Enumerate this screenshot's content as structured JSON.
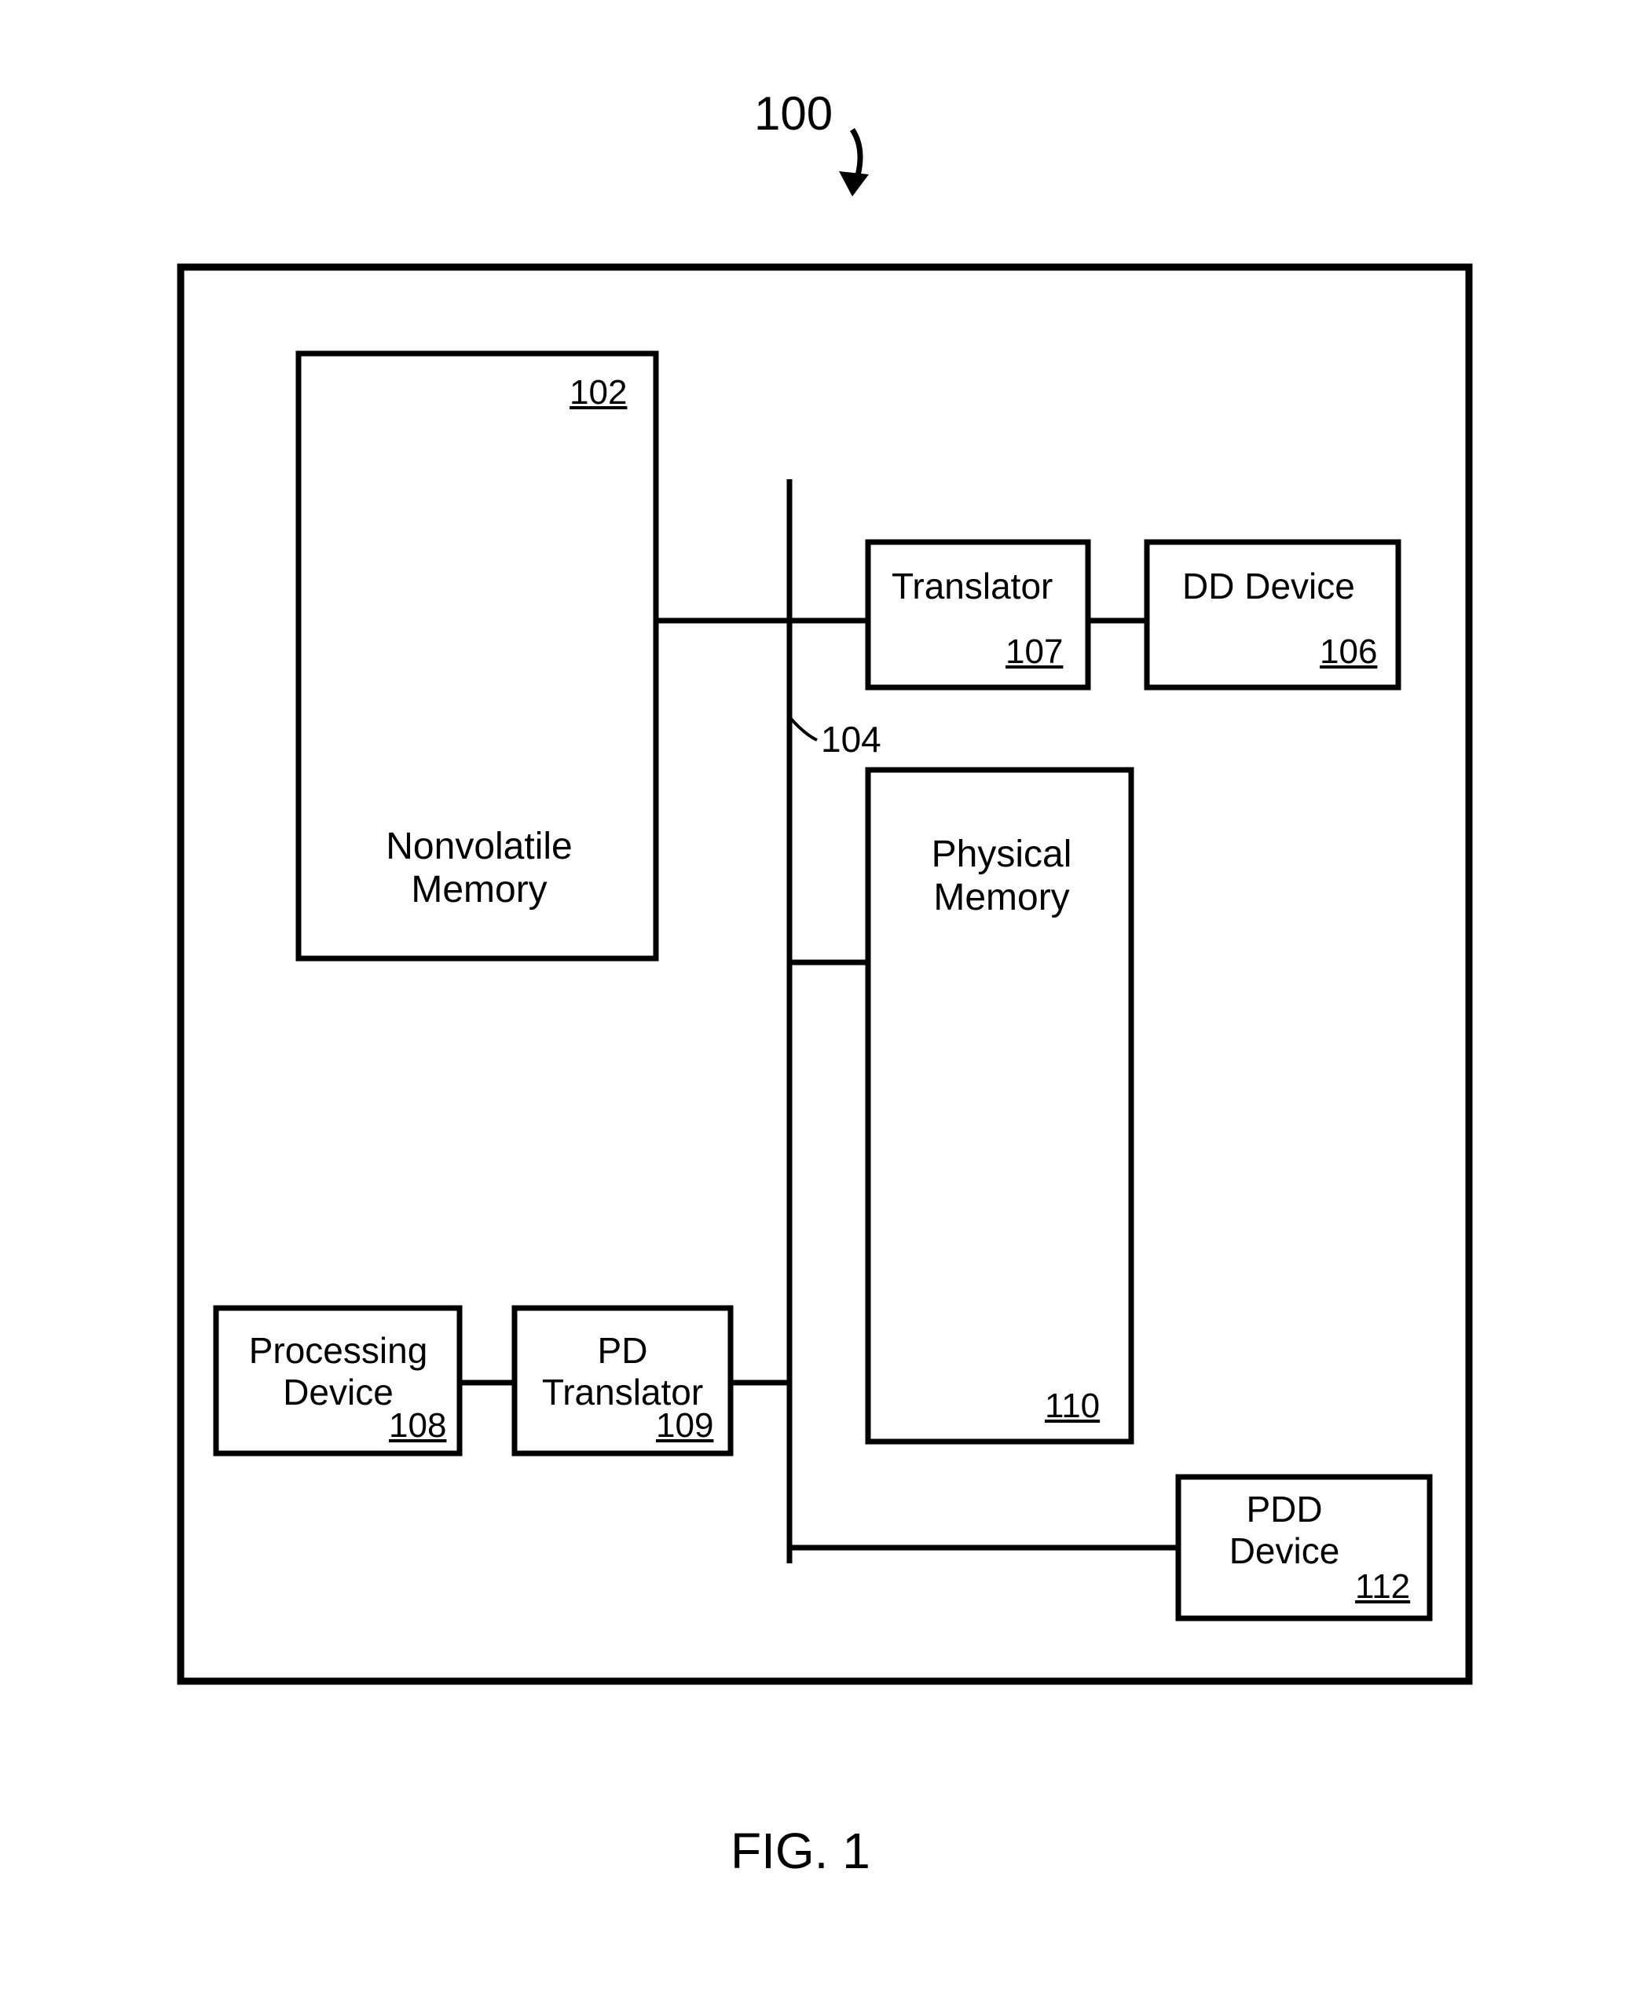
{
  "figure": {
    "caption": "FIG. 1",
    "topRef": "100"
  },
  "blocks": {
    "nvm": {
      "label": "Nonvolatile\nMemory",
      "ref": "102"
    },
    "trans": {
      "label": "Translator",
      "ref": "107"
    },
    "dd": {
      "label": "DD Device",
      "ref": "106"
    },
    "pm": {
      "label": "Physical\nMemory",
      "ref": "110"
    },
    "proc": {
      "label": "Processing\nDevice",
      "ref": "108"
    },
    "pdt": {
      "label": "PD\nTranslator",
      "ref": "109"
    },
    "pdd": {
      "label": "PDD\nDevice",
      "ref": "112"
    }
  },
  "busRef": "104"
}
